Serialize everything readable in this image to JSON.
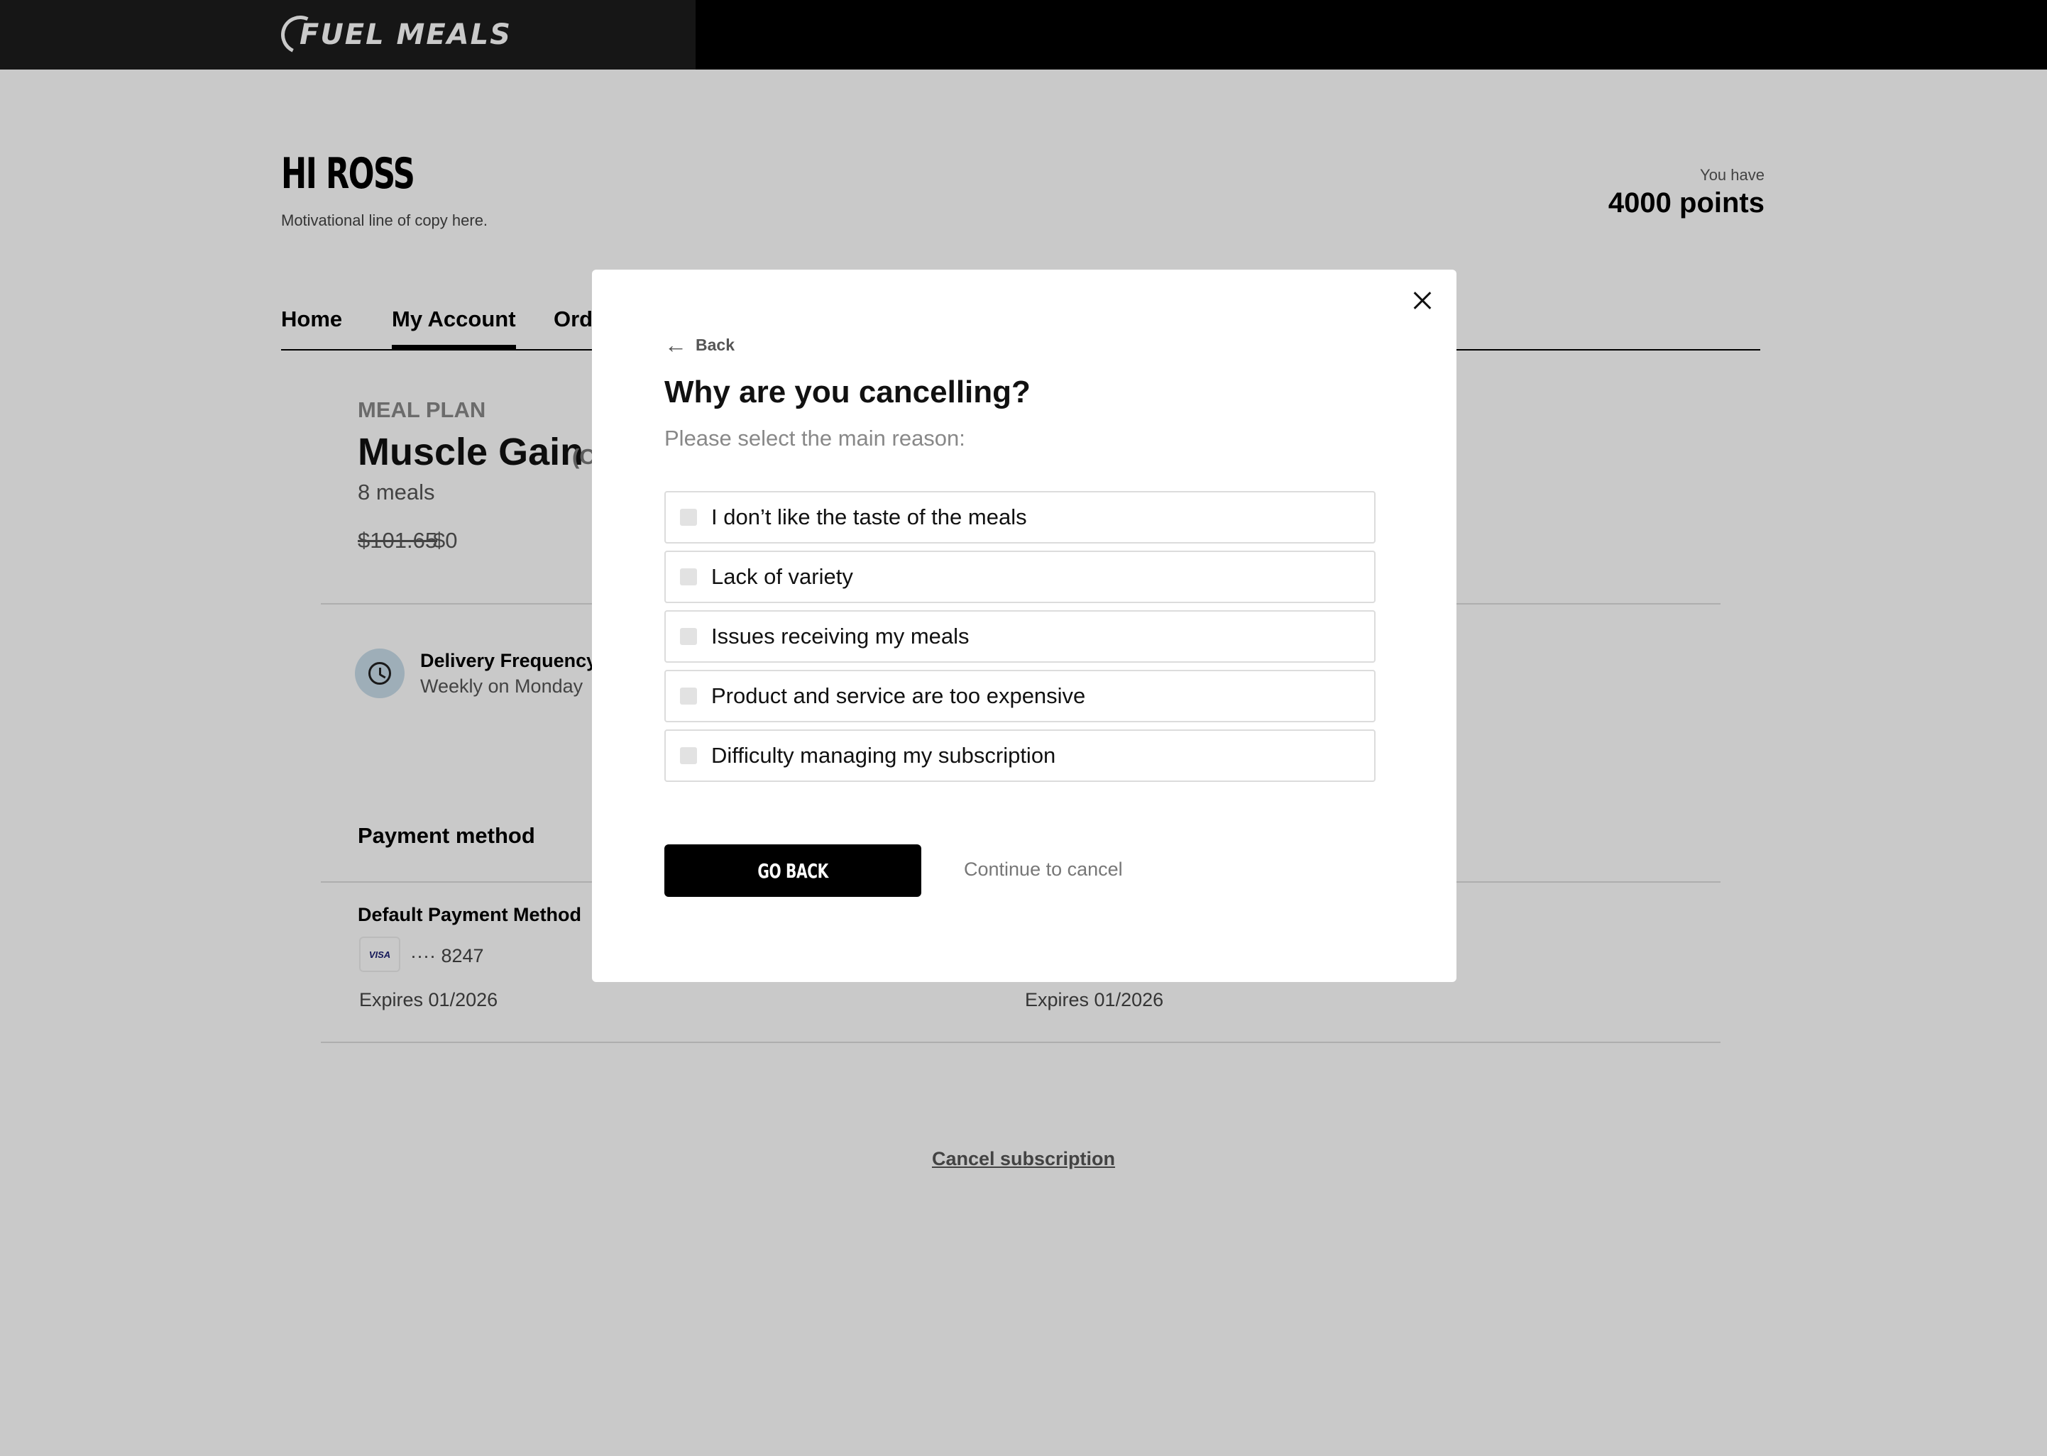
{
  "header": {
    "logo_text": "FUEL MEALS"
  },
  "greeting": {
    "title": "HI ROSS",
    "subtitle": "Motivational line of copy here."
  },
  "points": {
    "label": "You have",
    "value": "4000 points"
  },
  "tabs": [
    {
      "label": "Home"
    },
    {
      "label": "My Account"
    },
    {
      "label": "Orde"
    }
  ],
  "plan": {
    "label": "MEAL PLAN",
    "name": "Muscle Gain",
    "name_suffix": "(C",
    "meals": "8 meals",
    "price_old": "$101.65",
    "price_new": "$0",
    "frequency_title": "Delivery Frequency",
    "frequency_value": "Weekly on Monday"
  },
  "payment": {
    "title": "Payment method",
    "default_label": "Default Payment Method",
    "card_brand": "VISA",
    "card_number": "···· 8247",
    "expires_1": "Expires 01/2026",
    "expires_2": "Expires 01/2026"
  },
  "cancel_subscription": "Cancel subscription",
  "modal": {
    "back_label": "Back",
    "title": "Why are you cancelling?",
    "subtitle": "Please select the main reason:",
    "options": [
      {
        "label": "I don’t like the taste of the meals"
      },
      {
        "label": "Lack of variety"
      },
      {
        "label": "Issues receiving my meals"
      },
      {
        "label": "Product and service are too expensive"
      },
      {
        "label": "Difficulty managing my subscription"
      }
    ],
    "go_back_label": "GO BACK",
    "continue_label": "Continue to cancel"
  },
  "colors": {
    "overlay": "#000000",
    "primary_button": "#000000",
    "clock_bg": "#c9ddea"
  }
}
